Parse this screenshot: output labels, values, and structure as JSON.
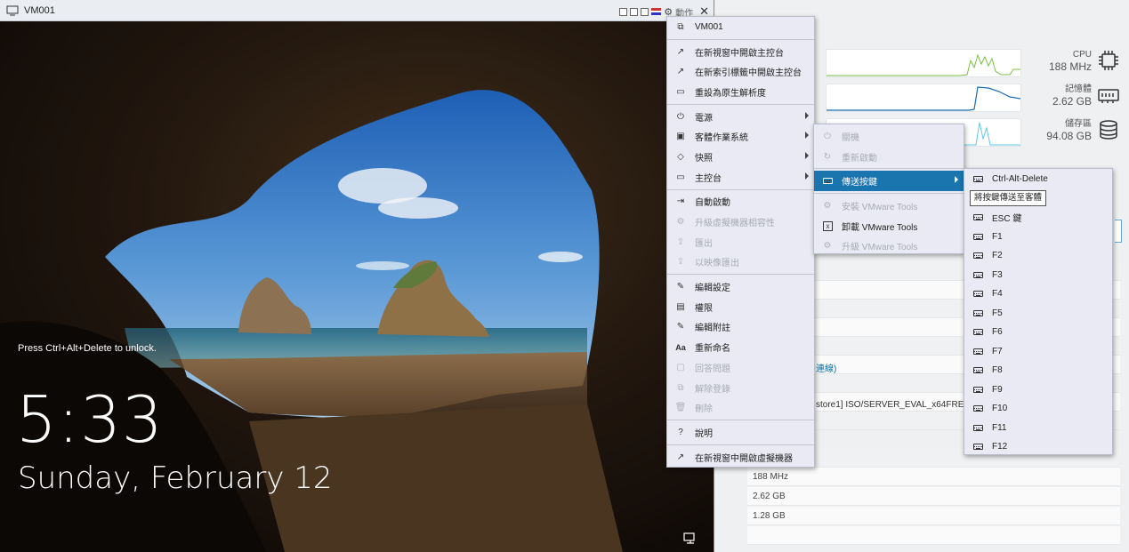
{
  "window": {
    "title": "VM001",
    "actions_label": "動作"
  },
  "lockscreen": {
    "message": "Press Ctrl+Alt+Delete to unlock.",
    "time": "5:33",
    "date": "Sunday, February 12"
  },
  "resources": [
    {
      "label": "CPU",
      "value": "188 MHz",
      "icon": "cpu-icon",
      "color": "#7ac143"
    },
    {
      "label": "記憶體",
      "value": "2.62 GB",
      "icon": "memory-icon",
      "color": "#1a6db5"
    },
    {
      "label": "儲存區",
      "value": "94.08 GB",
      "icon": "storage-icon",
      "color": "#61c7e6"
    }
  ],
  "background_page": {
    "link_text": "連線)",
    "iso_text": "store1] ISO/SERVER_EVAL_x64FRE",
    "rows": [
      "188 MHz",
      "2.62 GB",
      "1.28 GB"
    ]
  },
  "main_menu": {
    "header": "VM001",
    "items": [
      {
        "label": "在新視窗中開啟主控台",
        "icon": "open-external-icon",
        "disabled": false
      },
      {
        "label": "在新索引標籤中開啟主控台",
        "icon": "open-external-icon",
        "disabled": false
      },
      {
        "label": "重設為原生解析度",
        "icon": "monitor-icon",
        "disabled": false
      },
      {
        "label": "電源",
        "icon": "power-icon",
        "disabled": false,
        "submenu": true
      },
      {
        "label": "客體作業系統",
        "icon": "window-icon",
        "disabled": false,
        "submenu": true
      },
      {
        "label": "快照",
        "icon": "tag-icon",
        "disabled": false,
        "submenu": true
      },
      {
        "label": "主控台",
        "icon": "console-icon",
        "disabled": false,
        "submenu": true
      },
      {
        "label": "自動啟動",
        "icon": "autostart-icon",
        "disabled": false
      },
      {
        "label": "升級虛擬機器相容性",
        "icon": "upgrade-icon",
        "disabled": true
      },
      {
        "label": "匯出",
        "icon": "export-icon",
        "disabled": true
      },
      {
        "label": "以映像匯出",
        "icon": "export-image-icon",
        "disabled": true
      },
      {
        "label": "編輯設定",
        "icon": "edit-settings-icon",
        "disabled": false
      },
      {
        "label": "權限",
        "icon": "permissions-icon",
        "disabled": false
      },
      {
        "label": "編輯附註",
        "icon": "edit-notes-icon",
        "disabled": false
      },
      {
        "label": "重新命名",
        "icon": "rename-icon",
        "disabled": false
      },
      {
        "label": "回答問題",
        "icon": "question-chat-icon",
        "disabled": true
      },
      {
        "label": "解除登錄",
        "icon": "unregister-icon",
        "disabled": true
      },
      {
        "label": "刪除",
        "icon": "trash-icon",
        "disabled": true
      },
      {
        "label": "說明",
        "icon": "help-icon",
        "disabled": false
      },
      {
        "label": "在新視窗中開啟虛擬機器",
        "icon": "open-external-icon",
        "disabled": false
      }
    ]
  },
  "guest_menu": {
    "items": [
      {
        "label": "關機",
        "icon": "shutdown-icon",
        "disabled": true
      },
      {
        "label": "重新啟動",
        "icon": "restart-icon",
        "disabled": true
      },
      {
        "label": "傳送按鍵",
        "icon": "keyboard-icon",
        "disabled": false,
        "highlighted": true
      },
      {
        "label": "安裝 VMware Tools",
        "icon": "install-icon",
        "disabled": true
      },
      {
        "label": "卸載 VMware Tools",
        "icon": "unmount-icon",
        "disabled": false
      },
      {
        "label": "升級 VMware Tools",
        "icon": "upgrade-tools-icon",
        "disabled": true
      }
    ]
  },
  "keys_menu": {
    "tooltip": "將按鍵傳送至客體",
    "items": [
      "Ctrl-Alt-Delete",
      "ESC 鍵",
      "F1",
      "F2",
      "F3",
      "F4",
      "F5",
      "F6",
      "F7",
      "F8",
      "F9",
      "F10",
      "F11",
      "F12"
    ]
  }
}
